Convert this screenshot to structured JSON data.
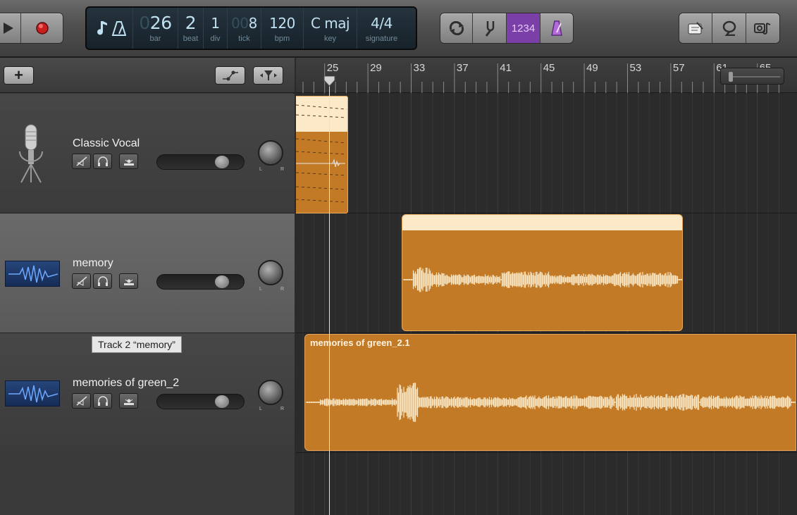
{
  "transport": {
    "play_icon": "play-icon",
    "record_icon": "record-icon",
    "record_color": "#c81e1e"
  },
  "lcd": {
    "note_icon": "music-note-icon",
    "bar": {
      "value": "26",
      "label": "bar"
    },
    "beat": {
      "value": "2",
      "label": "beat"
    },
    "div": {
      "value": "1",
      "label": "div"
    },
    "tick": {
      "value": "8",
      "label": "tick"
    },
    "bpm": {
      "value": "120",
      "label": "bpm"
    },
    "key": {
      "value": "C maj",
      "label": "key"
    },
    "signature": {
      "value": "4/4",
      "label": "signature"
    }
  },
  "tools": {
    "count_in_label": "1234",
    "accent_color": "#7b3fa8"
  },
  "header_toolbar": {
    "add_label": "+"
  },
  "ruler": {
    "bars": [
      "25",
      "29",
      "33",
      "37",
      "41",
      "45",
      "49",
      "53",
      "57",
      "61",
      "65"
    ]
  },
  "tracks": [
    {
      "name": "Classic Vocal",
      "icon": "microphone-icon",
      "selected": false,
      "volume": 0.8
    },
    {
      "name": "memory",
      "icon": "waveform-icon",
      "selected": true,
      "volume": 0.8
    },
    {
      "name": "memories of green_2",
      "icon": "waveform-icon",
      "selected": false,
      "volume": 0.8
    }
  ],
  "tooltip": "Track 2 “memory”",
  "regions": [
    {
      "track": 1,
      "name": ""
    },
    {
      "track": 2,
      "name": ""
    },
    {
      "track": 3,
      "name": "memories of green_2.1"
    }
  ],
  "colors": {
    "region": "#c27a26",
    "region_top": "#fce9c8",
    "lcd_text": "#bfe0f0"
  }
}
